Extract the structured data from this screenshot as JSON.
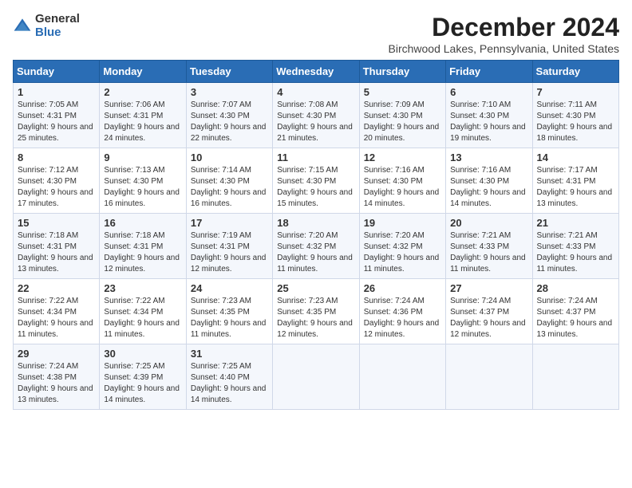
{
  "logo": {
    "general": "General",
    "blue": "Blue"
  },
  "title": "December 2024",
  "location": "Birchwood Lakes, Pennsylvania, United States",
  "days_of_week": [
    "Sunday",
    "Monday",
    "Tuesday",
    "Wednesday",
    "Thursday",
    "Friday",
    "Saturday"
  ],
  "weeks": [
    [
      {
        "day": "1",
        "sunrise": "7:05 AM",
        "sunset": "4:31 PM",
        "daylight": "9 hours and 25 minutes."
      },
      {
        "day": "2",
        "sunrise": "7:06 AM",
        "sunset": "4:31 PM",
        "daylight": "9 hours and 24 minutes."
      },
      {
        "day": "3",
        "sunrise": "7:07 AM",
        "sunset": "4:30 PM",
        "daylight": "9 hours and 22 minutes."
      },
      {
        "day": "4",
        "sunrise": "7:08 AM",
        "sunset": "4:30 PM",
        "daylight": "9 hours and 21 minutes."
      },
      {
        "day": "5",
        "sunrise": "7:09 AM",
        "sunset": "4:30 PM",
        "daylight": "9 hours and 20 minutes."
      },
      {
        "day": "6",
        "sunrise": "7:10 AM",
        "sunset": "4:30 PM",
        "daylight": "9 hours and 19 minutes."
      },
      {
        "day": "7",
        "sunrise": "7:11 AM",
        "sunset": "4:30 PM",
        "daylight": "9 hours and 18 minutes."
      }
    ],
    [
      {
        "day": "8",
        "sunrise": "7:12 AM",
        "sunset": "4:30 PM",
        "daylight": "9 hours and 17 minutes."
      },
      {
        "day": "9",
        "sunrise": "7:13 AM",
        "sunset": "4:30 PM",
        "daylight": "9 hours and 16 minutes."
      },
      {
        "day": "10",
        "sunrise": "7:14 AM",
        "sunset": "4:30 PM",
        "daylight": "9 hours and 16 minutes."
      },
      {
        "day": "11",
        "sunrise": "7:15 AM",
        "sunset": "4:30 PM",
        "daylight": "9 hours and 15 minutes."
      },
      {
        "day": "12",
        "sunrise": "7:16 AM",
        "sunset": "4:30 PM",
        "daylight": "9 hours and 14 minutes."
      },
      {
        "day": "13",
        "sunrise": "7:16 AM",
        "sunset": "4:30 PM",
        "daylight": "9 hours and 14 minutes."
      },
      {
        "day": "14",
        "sunrise": "7:17 AM",
        "sunset": "4:31 PM",
        "daylight": "9 hours and 13 minutes."
      }
    ],
    [
      {
        "day": "15",
        "sunrise": "7:18 AM",
        "sunset": "4:31 PM",
        "daylight": "9 hours and 13 minutes."
      },
      {
        "day": "16",
        "sunrise": "7:18 AM",
        "sunset": "4:31 PM",
        "daylight": "9 hours and 12 minutes."
      },
      {
        "day": "17",
        "sunrise": "7:19 AM",
        "sunset": "4:31 PM",
        "daylight": "9 hours and 12 minutes."
      },
      {
        "day": "18",
        "sunrise": "7:20 AM",
        "sunset": "4:32 PM",
        "daylight": "9 hours and 11 minutes."
      },
      {
        "day": "19",
        "sunrise": "7:20 AM",
        "sunset": "4:32 PM",
        "daylight": "9 hours and 11 minutes."
      },
      {
        "day": "20",
        "sunrise": "7:21 AM",
        "sunset": "4:33 PM",
        "daylight": "9 hours and 11 minutes."
      },
      {
        "day": "21",
        "sunrise": "7:21 AM",
        "sunset": "4:33 PM",
        "daylight": "9 hours and 11 minutes."
      }
    ],
    [
      {
        "day": "22",
        "sunrise": "7:22 AM",
        "sunset": "4:34 PM",
        "daylight": "9 hours and 11 minutes."
      },
      {
        "day": "23",
        "sunrise": "7:22 AM",
        "sunset": "4:34 PM",
        "daylight": "9 hours and 11 minutes."
      },
      {
        "day": "24",
        "sunrise": "7:23 AM",
        "sunset": "4:35 PM",
        "daylight": "9 hours and 11 minutes."
      },
      {
        "day": "25",
        "sunrise": "7:23 AM",
        "sunset": "4:35 PM",
        "daylight": "9 hours and 12 minutes."
      },
      {
        "day": "26",
        "sunrise": "7:24 AM",
        "sunset": "4:36 PM",
        "daylight": "9 hours and 12 minutes."
      },
      {
        "day": "27",
        "sunrise": "7:24 AM",
        "sunset": "4:37 PM",
        "daylight": "9 hours and 12 minutes."
      },
      {
        "day": "28",
        "sunrise": "7:24 AM",
        "sunset": "4:37 PM",
        "daylight": "9 hours and 13 minutes."
      }
    ],
    [
      {
        "day": "29",
        "sunrise": "7:24 AM",
        "sunset": "4:38 PM",
        "daylight": "9 hours and 13 minutes."
      },
      {
        "day": "30",
        "sunrise": "7:25 AM",
        "sunset": "4:39 PM",
        "daylight": "9 hours and 14 minutes."
      },
      {
        "day": "31",
        "sunrise": "7:25 AM",
        "sunset": "4:40 PM",
        "daylight": "9 hours and 14 minutes."
      },
      null,
      null,
      null,
      null
    ]
  ],
  "labels": {
    "sunrise": "Sunrise:",
    "sunset": "Sunset:",
    "daylight": "Daylight:"
  }
}
